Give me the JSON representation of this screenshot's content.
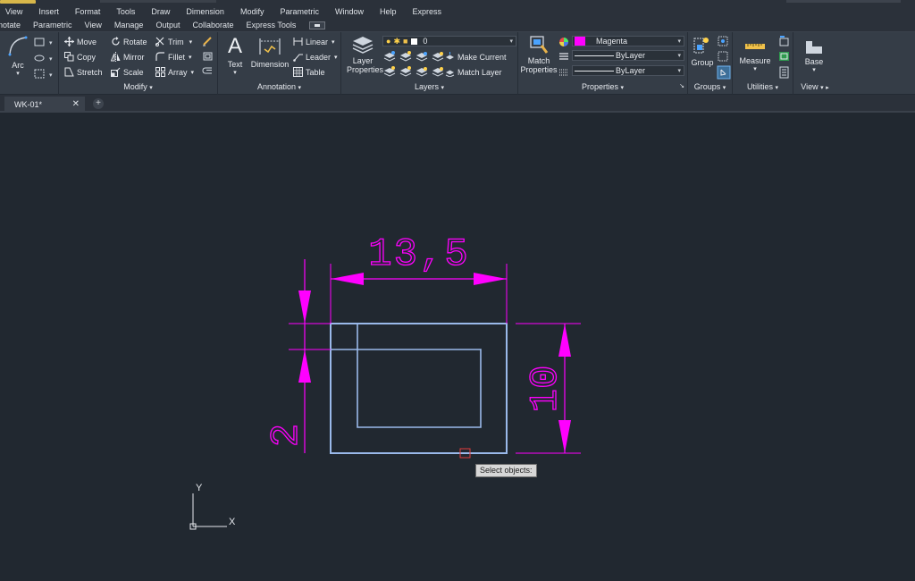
{
  "menubar": [
    "View",
    "Insert",
    "Format",
    "Tools",
    "Draw",
    "Dimension",
    "Modify",
    "Parametric",
    "Window",
    "Help",
    "Express"
  ],
  "ribbon_tabs": [
    "notate",
    "Parametric",
    "View",
    "Manage",
    "Output",
    "Collaborate",
    "Express Tools"
  ],
  "draw": {
    "arc": "Arc"
  },
  "modify": {
    "title": "Modify",
    "move": "Move",
    "rotate": "Rotate",
    "trim": "Trim",
    "copy": "Copy",
    "mirror": "Mirror",
    "fillet": "Fillet",
    "stretch": "Stretch",
    "scale": "Scale",
    "array": "Array"
  },
  "annotation": {
    "title": "Annotation",
    "text": "Text",
    "dimension": "Dimension",
    "linear": "Linear",
    "leader": "Leader",
    "table": "Table"
  },
  "layers": {
    "title": "Layers",
    "layer_properties": [
      "Layer",
      "Properties"
    ],
    "current_layer": "0",
    "make_current": "Make Current",
    "match_layer": "Match Layer"
  },
  "properties": {
    "title": "Properties",
    "match_properties": [
      "Match",
      "Properties"
    ],
    "color": "Magenta",
    "color_hex": "#ff00ff",
    "linetype": "ByLayer",
    "lineweight": "ByLayer"
  },
  "groups": {
    "title": "Groups",
    "group": "Group"
  },
  "utilities": {
    "title": "Utilities",
    "measure": "Measure"
  },
  "view_panel": {
    "title": "View",
    "base": "Base"
  },
  "doc_tab": {
    "name": "WK-01*",
    "add": "+"
  },
  "drawing": {
    "dim_width": "13,5",
    "dim_height": "10",
    "dim_left": "2",
    "ucs_y": "Y",
    "ucs_x": "X"
  },
  "tooltip": "Select objects:",
  "colors": {
    "dimension": "#ff00ff",
    "geometry": "#9ab9ea",
    "background": "#212830",
    "ribbon": "#353d47"
  }
}
